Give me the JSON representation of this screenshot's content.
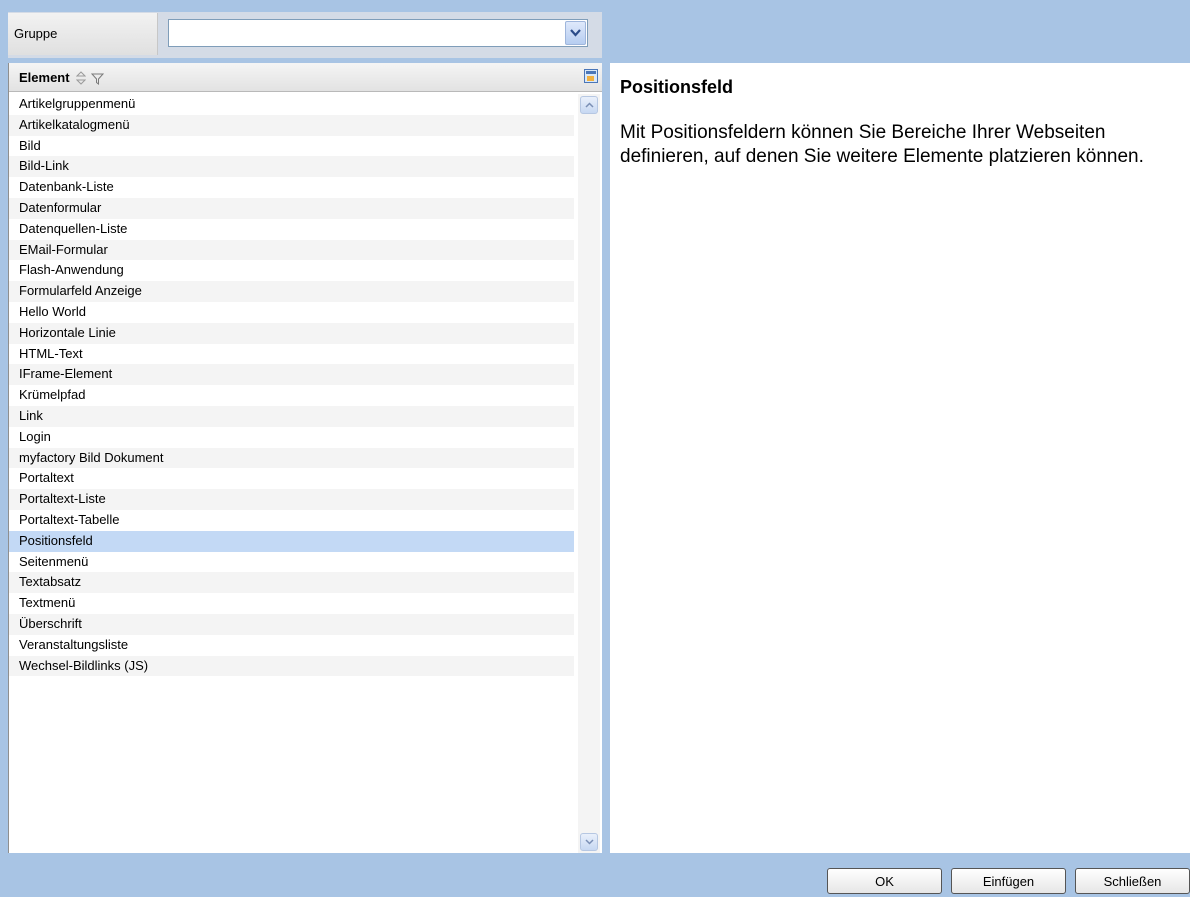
{
  "filter": {
    "group_label": "Gruppe",
    "group_value": ""
  },
  "list": {
    "column_header": "Element",
    "items": [
      "Artikelgruppenmenü",
      "Artikelkatalogmenü",
      "Bild",
      "Bild-Link",
      "Datenbank-Liste",
      "Datenformular",
      "Datenquellen-Liste",
      "EMail-Formular",
      "Flash-Anwendung",
      "Formularfeld Anzeige",
      "Hello World",
      "Horizontale Linie",
      "HTML-Text",
      "IFrame-Element",
      "Krümelpfad",
      "Link",
      "Login",
      "myfactory Bild Dokument",
      "Portaltext",
      "Portaltext-Liste",
      "Portaltext-Tabelle",
      "Positionsfeld",
      "Seitenmenü",
      "Textabsatz",
      "Textmenü",
      "Überschrift",
      "Veranstaltungsliste",
      "Wechsel-Bildlinks (JS)"
    ],
    "selected_index": 21
  },
  "description": {
    "title": "Positionsfeld",
    "text": "Mit Positionsfeldern können Sie Bereiche Ihrer Webseiten definieren, auf denen Sie weitere Elemente platzieren können."
  },
  "buttons": {
    "ok": "OK",
    "insert": "Einfügen",
    "close": "Schließen"
  },
  "colors": {
    "background": "#a8c4e4",
    "selection": "#c3d9f5"
  },
  "icons": {
    "sort": "sort-arrows-icon",
    "filter": "filter-funnel-icon",
    "export": "export-grid-icon",
    "dropdown": "chevron-down-icon"
  }
}
